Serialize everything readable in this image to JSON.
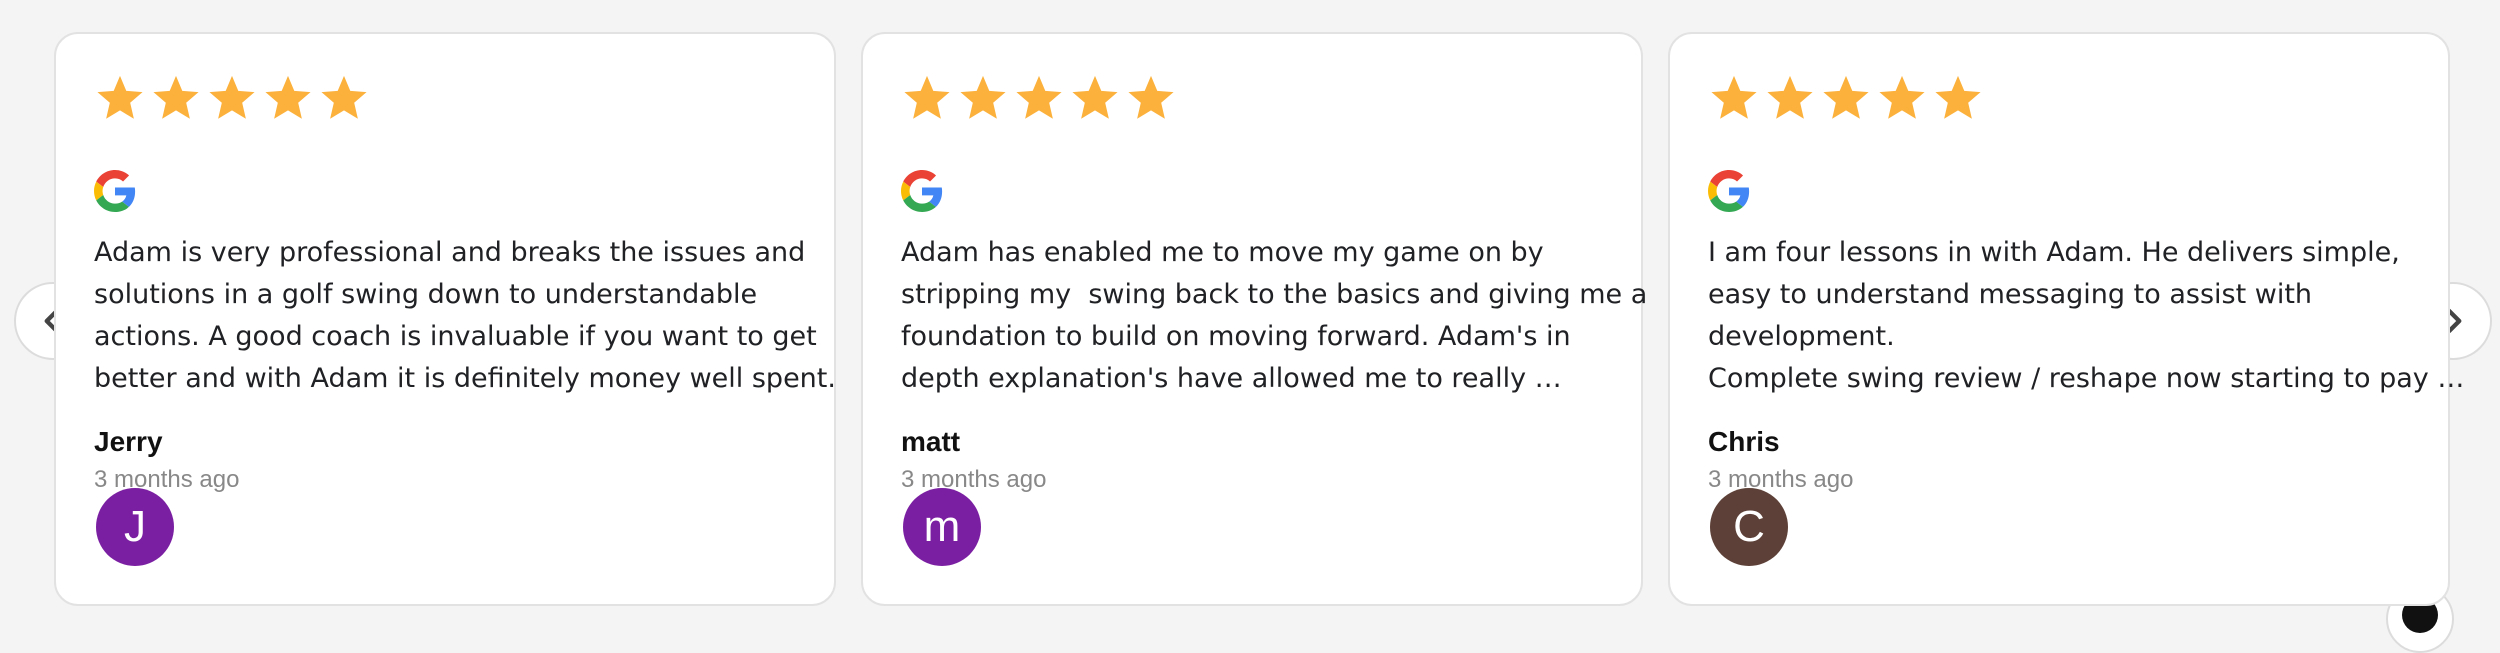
{
  "theme": {
    "star_color": "#FBB13C",
    "nav_arrow_color": "#444444"
  },
  "navigation": {
    "prev_icon": "chevron-left-icon",
    "next_icon": "chevron-right-icon"
  },
  "reviews": [
    {
      "rating": 5,
      "source_icon": "google-icon",
      "text_lines": [
        "Adam is very professional and breaks the issues and",
        "solutions in a golf swing down to understandable",
        "actions. A good coach is invaluable if you want to get",
        "better and with Adam it is definitely money well spent."
      ],
      "author": "Jerry",
      "date": "3 months ago",
      "avatar_initial": "J",
      "avatar_color": "#7B1FA2"
    },
    {
      "rating": 5,
      "source_icon": "google-icon",
      "text_lines": [
        "Adam has enabled me to move my game on by",
        "stripping my  swing back to the basics and giving me a",
        "foundation to build on moving forward. Adam's in",
        "depth explanation's have allowed me to really …"
      ],
      "author": "matt",
      "date": "3 months ago",
      "avatar_initial": "m",
      "avatar_color": "#7B1FA2"
    },
    {
      "rating": 5,
      "source_icon": "google-icon",
      "text_lines": [
        "I am four lessons in with Adam. He delivers simple,",
        "easy to understand messaging to assist with",
        "development.",
        "Complete swing review / reshape now starting to pay …"
      ],
      "author": "Chris",
      "date": "3 months ago",
      "avatar_initial": "C",
      "avatar_color": "#5D4037"
    }
  ]
}
